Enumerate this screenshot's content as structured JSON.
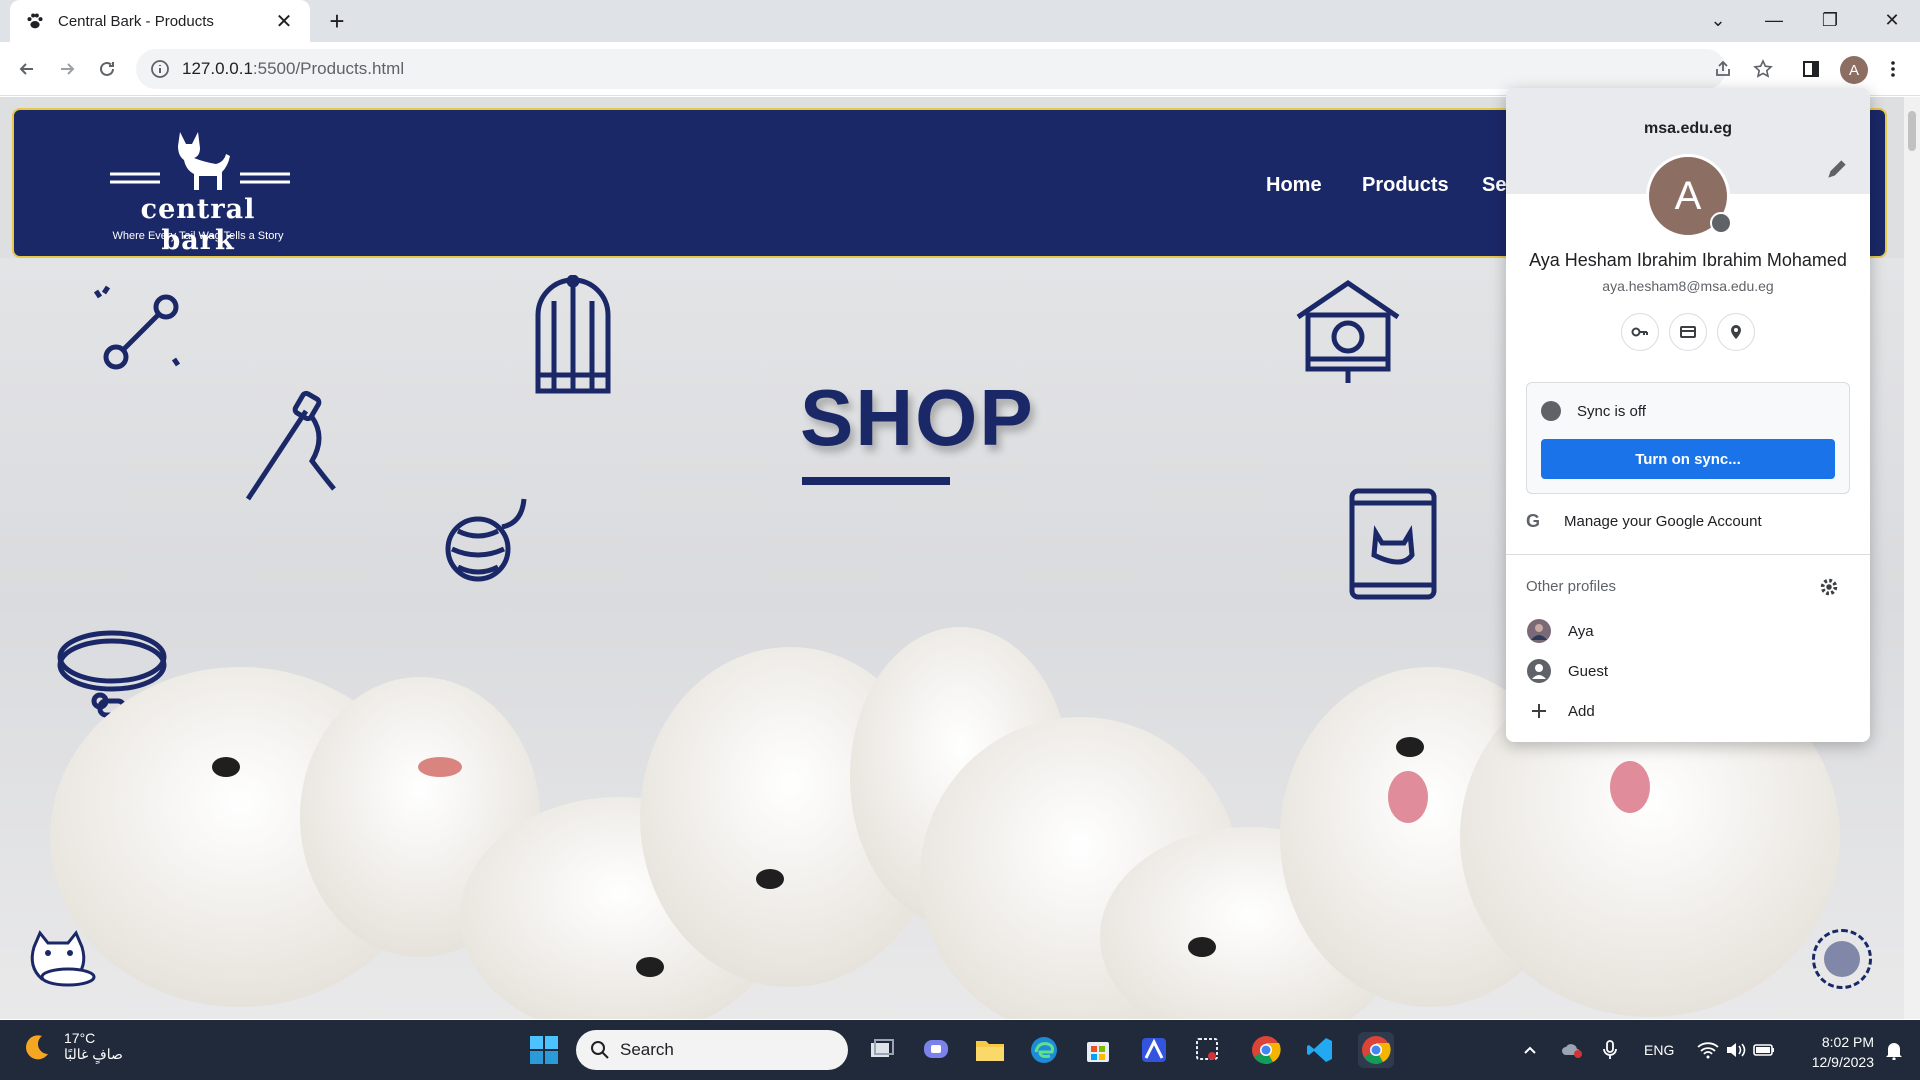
{
  "browser": {
    "tab": {
      "title": "Central Bark - Products",
      "favicon": "paw-icon"
    },
    "url": {
      "host": "127.0.0.1",
      "rest": ":5500/Products.html"
    },
    "profile_initial": "A"
  },
  "site": {
    "logo": {
      "name": "central bark",
      "tagline": "Where Every Tail Wag Tells a Story"
    },
    "nav": [
      {
        "label": "Home"
      },
      {
        "label": "Products"
      },
      {
        "label": "Se"
      }
    ],
    "hero": {
      "title": "SHOP"
    },
    "accent_colors": {
      "navy": "#1b2868",
      "gold": "#e6c84a"
    }
  },
  "profile_popup": {
    "domain": "msa.edu.eg",
    "initial": "A",
    "name": "Aya Hesham Ibrahim Ibrahim Mohamed",
    "email": "aya.hesham8@msa.edu.eg",
    "quick_icons": [
      "key-icon",
      "card-icon",
      "location-icon"
    ],
    "sync_status": "Sync is off",
    "sync_button": "Turn on sync...",
    "manage_account": "Manage your Google Account",
    "other_profiles_label": "Other profiles",
    "profiles": [
      {
        "label": "Aya",
        "icon": "profile-photo-icon"
      },
      {
        "label": "Guest",
        "icon": "guest-icon"
      },
      {
        "label": "Add",
        "icon": "plus-icon"
      }
    ]
  },
  "taskbar": {
    "weather": {
      "temp": "17°C",
      "desc": "صافٍ غالبًا"
    },
    "search_label": "Search",
    "language": "ENG",
    "time": "8:02 PM",
    "date": "12/9/2023"
  }
}
